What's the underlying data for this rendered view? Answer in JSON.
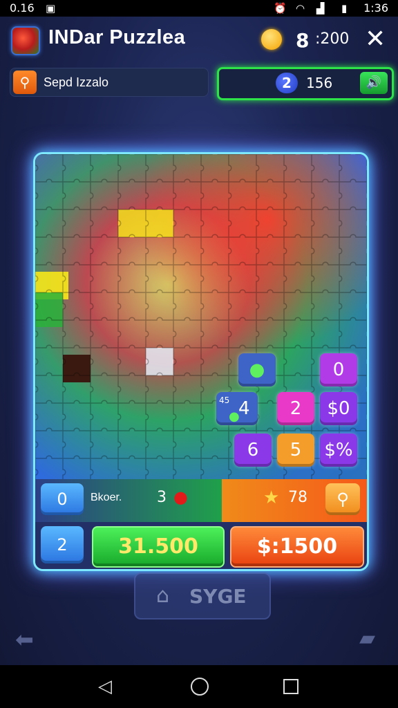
{
  "status_bar": {
    "left_text": "0.16",
    "right_text": "1:36"
  },
  "header": {
    "title": "INDar Puzzlea",
    "gem_count": ":200",
    "gem_glyph": "8",
    "close_glyph": "✕"
  },
  "info_bar": {
    "mode_label": "Sepd Izzalo",
    "level": "2",
    "score": "156"
  },
  "tiles": [
    {
      "label": "",
      "icon": "green-apple-icon",
      "color": "#3f64c8"
    },
    {
      "label": "0",
      "color": "#b23be8"
    },
    {
      "label": "4",
      "small_label": "45",
      "icon": "green-apple-icon",
      "color": "#3f64c8"
    },
    {
      "label": "2",
      "color": "#e839c9"
    },
    {
      "label": "$0",
      "color": "#8b39e8"
    },
    {
      "label": "6",
      "color": "#8b39e8"
    },
    {
      "label": "5",
      "color": "#f59d2a"
    },
    {
      "label": "$%",
      "color": "#8b39e8"
    }
  ],
  "bottom_panel": {
    "counter_top": "0",
    "counter_bottom": "2",
    "stat_label": "Bkoer.",
    "stat_value": "3",
    "star_value": "78",
    "green_total": "31.500",
    "orange_total": "$:1500"
  },
  "footer": {
    "save_label": "SYGE"
  },
  "colors": {
    "accent_green": "#2ee24a",
    "frame_glow": "#7ee8ff",
    "orange": "#f5631f"
  }
}
